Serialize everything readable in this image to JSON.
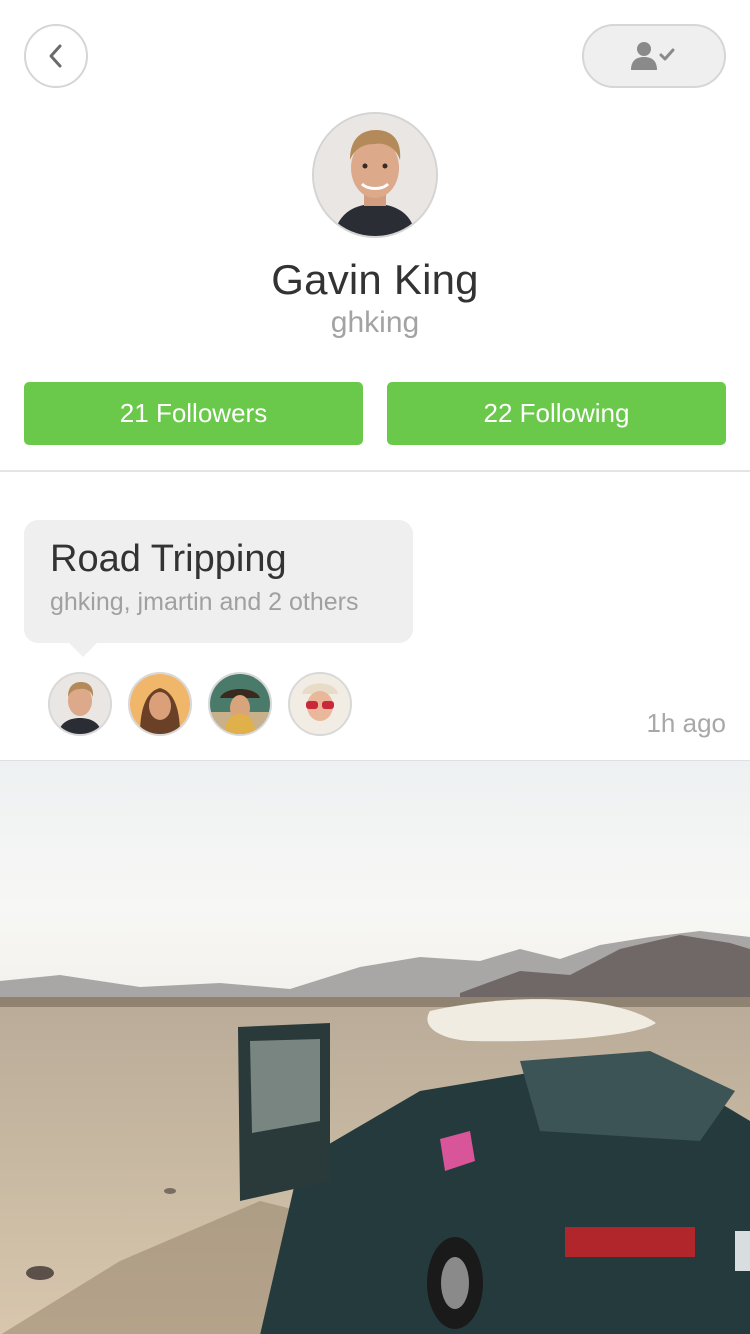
{
  "topbar": {
    "back_icon": "chevron-left-icon",
    "follow_icon": "user-check-icon"
  },
  "profile": {
    "name": "Gavin King",
    "username": "ghking"
  },
  "stats": {
    "followers_label": "21 Followers",
    "following_label": "22 Following"
  },
  "trip": {
    "title": "Road Tripping",
    "members_text": "ghking, jmartin and 2 others",
    "time_ago": "1h ago"
  },
  "colors": {
    "accent_green": "#6ac94a",
    "bubble_gray": "#efefef",
    "muted_text": "#a3a3a3"
  }
}
